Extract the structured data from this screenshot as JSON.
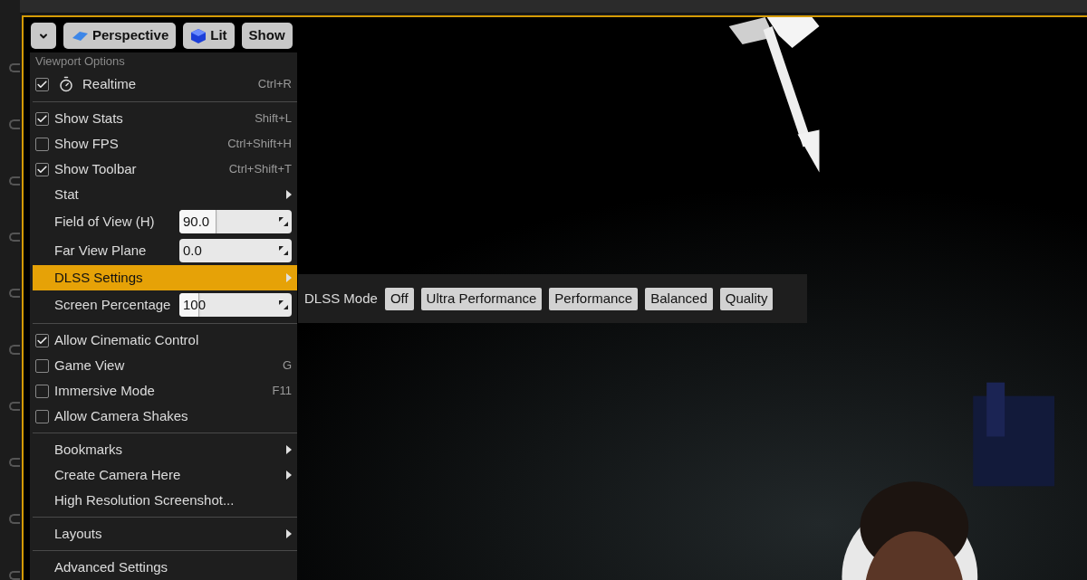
{
  "toolbar": {
    "buttons": [
      {
        "kind": "dropdown"
      },
      {
        "kind": "perspective",
        "label": "Perspective"
      },
      {
        "kind": "lit",
        "label": "Lit"
      },
      {
        "kind": "plain",
        "label": "Show"
      }
    ]
  },
  "menu": {
    "items": [
      {
        "kind": "header",
        "label": "Viewport Options"
      },
      {
        "kind": "check",
        "label": "Realtime",
        "checked": true,
        "icon": true,
        "shortcut": "Ctrl+R"
      },
      {
        "kind": "separator"
      },
      {
        "kind": "check",
        "label": "Show Stats",
        "checked": true,
        "shortcut": "Shift+L"
      },
      {
        "kind": "check",
        "label": "Show FPS",
        "checked": false,
        "shortcut": "Ctrl+Shift+H"
      },
      {
        "kind": "check",
        "label": "Show Toolbar",
        "checked": true,
        "shortcut": "Ctrl+Shift+T"
      },
      {
        "kind": "submenu",
        "label": "Stat",
        "selected": false
      },
      {
        "kind": "spin",
        "label": "Field of View (H)",
        "value": "90.0",
        "level": 0.33
      },
      {
        "kind": "spin",
        "label": "Far View Plane",
        "value": "0.0"
      },
      {
        "kind": "submenu",
        "label": "DLSS Settings",
        "selected": true
      },
      {
        "kind": "spin",
        "label": "Screen Percentage",
        "value": "100",
        "level": 0.18
      },
      {
        "kind": "separator"
      },
      {
        "kind": "check",
        "label": "Allow Cinematic Control",
        "checked": true
      },
      {
        "kind": "check",
        "label": "Game View",
        "checked": false,
        "shortcut": "G"
      },
      {
        "kind": "check",
        "label": "Immersive Mode",
        "checked": false,
        "shortcut": "F11"
      },
      {
        "kind": "check",
        "label": "Allow Camera Shakes",
        "checked": false
      },
      {
        "kind": "separator"
      },
      {
        "kind": "submenu",
        "label": "Bookmarks",
        "selected": false
      },
      {
        "kind": "submenu",
        "label": "Create Camera Here",
        "selected": false
      },
      {
        "kind": "action",
        "label": "High Resolution Screenshot...",
        "selected": false
      },
      {
        "kind": "separator"
      },
      {
        "kind": "submenu",
        "label": "Layouts",
        "selected": false
      },
      {
        "kind": "separator"
      },
      {
        "kind": "action",
        "label": "Advanced Settings",
        "selected": false
      }
    ]
  },
  "submenu": {
    "label": "DLSS Mode",
    "buttons": [
      "Off",
      "Ultra Performance",
      "Performance",
      "Balanced",
      "Quality"
    ]
  }
}
